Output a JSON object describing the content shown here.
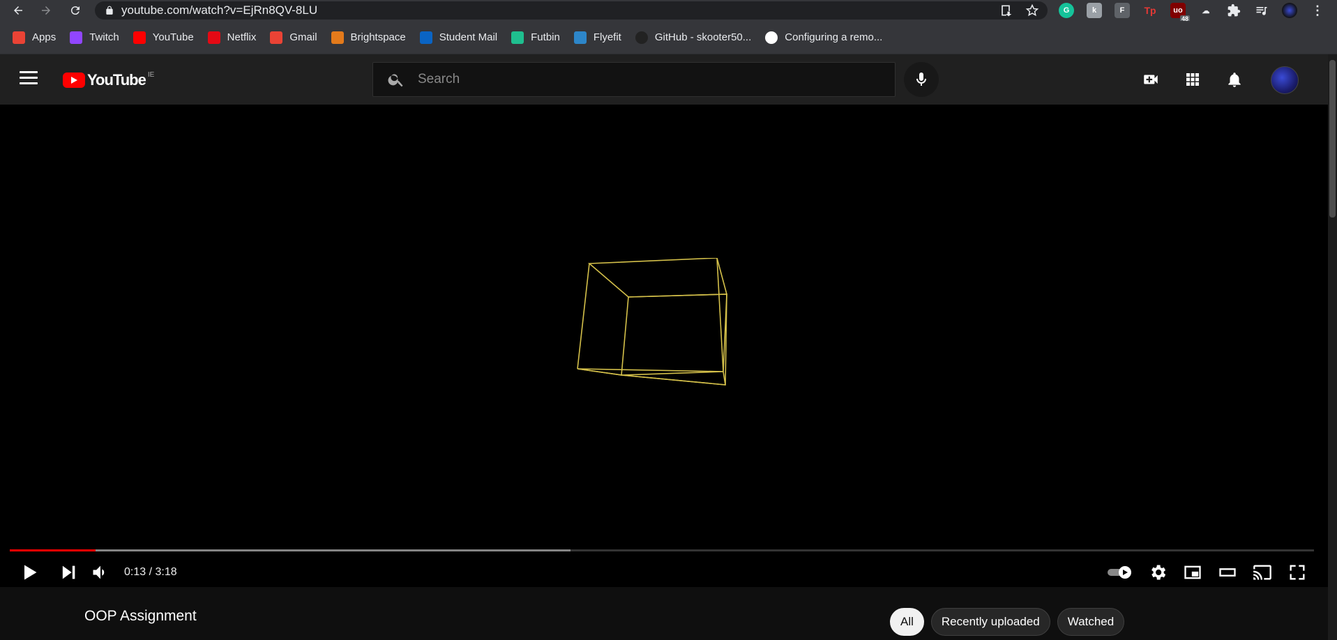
{
  "browser": {
    "url": "youtube.com/watch?v=EjRn8QV-8LU",
    "extension_badge": "48",
    "bookmarks": [
      {
        "label": "Apps",
        "icon": "apps-grid-icon",
        "color": "#ea4335"
      },
      {
        "label": "Twitch",
        "icon": "twitch-icon",
        "color": "#9146ff"
      },
      {
        "label": "YouTube",
        "icon": "youtube-icon",
        "color": "#ff0000"
      },
      {
        "label": "Netflix",
        "icon": "netflix-icon",
        "color": "#e50914"
      },
      {
        "label": "Gmail",
        "icon": "gmail-icon",
        "color": "#ea4335"
      },
      {
        "label": "Brightspace",
        "icon": "brightspace-icon",
        "color": "#e37a1b"
      },
      {
        "label": "Student Mail",
        "icon": "outlook-icon",
        "color": "#0a64c4"
      },
      {
        "label": "Futbin",
        "icon": "futbin-icon",
        "color": "#1fbf8f"
      },
      {
        "label": "Flyefit",
        "icon": "flyefit-icon",
        "color": "#2d86c9"
      },
      {
        "label": "GitHub - skooter50...",
        "icon": "github-icon",
        "color": "#222222"
      },
      {
        "label": "Configuring a remo...",
        "icon": "github-icon",
        "color": "#ffffff"
      }
    ]
  },
  "youtube": {
    "logo_text": "YouTube",
    "country_code": "IE",
    "search_placeholder": "Search",
    "player": {
      "current_time": "0:13",
      "duration": "3:18",
      "time_display": "0:13 / 3:18",
      "played_fraction": 0.066,
      "buffered_fraction": 0.43
    },
    "video_title": "OOP Assignment",
    "chips": [
      "All",
      "Recently uploaded",
      "Watched"
    ],
    "accent_color": "#ff0000",
    "cube_color": "#d4c04a"
  }
}
